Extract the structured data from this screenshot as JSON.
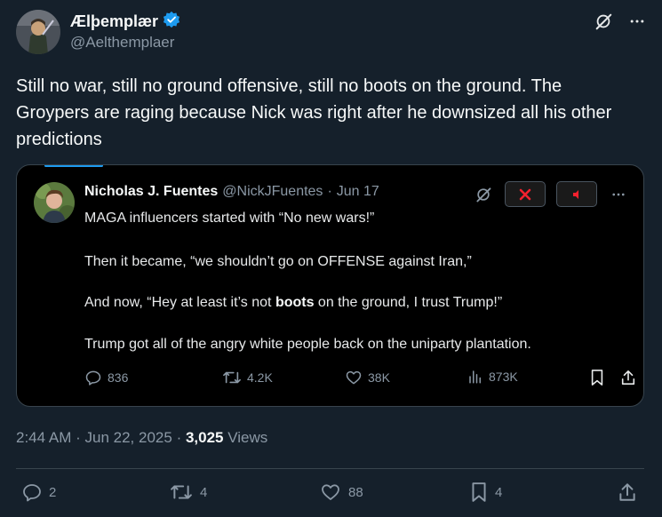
{
  "author": {
    "name": "Ælþemplær",
    "handle": "@Aelthemplaer",
    "verified": true,
    "verified_color": "#1d9bf0"
  },
  "tweet": {
    "text": "Still no war, still no ground offensive, still no boots on the ground. The Groypers are raging because Nick was right after he downsized all his other predictions"
  },
  "quote": {
    "name": "Nicholas J. Fuentes",
    "handle": "@NickJFuentes",
    "separator": "·",
    "date": "Jun 17",
    "lines": {
      "l1": "MAGA influencers started with “No new wars!”",
      "l2": "Then it became, “we shouldn’t go on OFFENSE against Iran,”",
      "l3_pre": "And now, “Hey at least it’s not ",
      "l3_bold": "boots",
      "l3_post": " on the ground, I trust Trump!”",
      "l4": "Trump got all of the angry white people back on the uniparty plantation."
    },
    "stats": {
      "replies": "836",
      "reposts": "4.2K",
      "likes": "38K",
      "views": "873K"
    }
  },
  "meta": {
    "time": "2:44 AM",
    "dot": "·",
    "date": "Jun 22, 2025",
    "views_count": "3,025",
    "views_label": "Views"
  },
  "actions": {
    "replies": "2",
    "reposts": "4",
    "likes": "88",
    "bookmarks": "4"
  },
  "colors": {
    "background": "#15202b",
    "quote_background": "#000000",
    "muted": "#8b98a5",
    "accent": "#1d9bf0",
    "close_red": "#f4212e"
  },
  "icons": [
    "grok-icon",
    "more-icon",
    "verified-badge-icon",
    "close-icon",
    "mute-icon",
    "reply-icon",
    "repost-icon",
    "like-icon",
    "views-icon",
    "bookmark-icon",
    "share-icon"
  ]
}
